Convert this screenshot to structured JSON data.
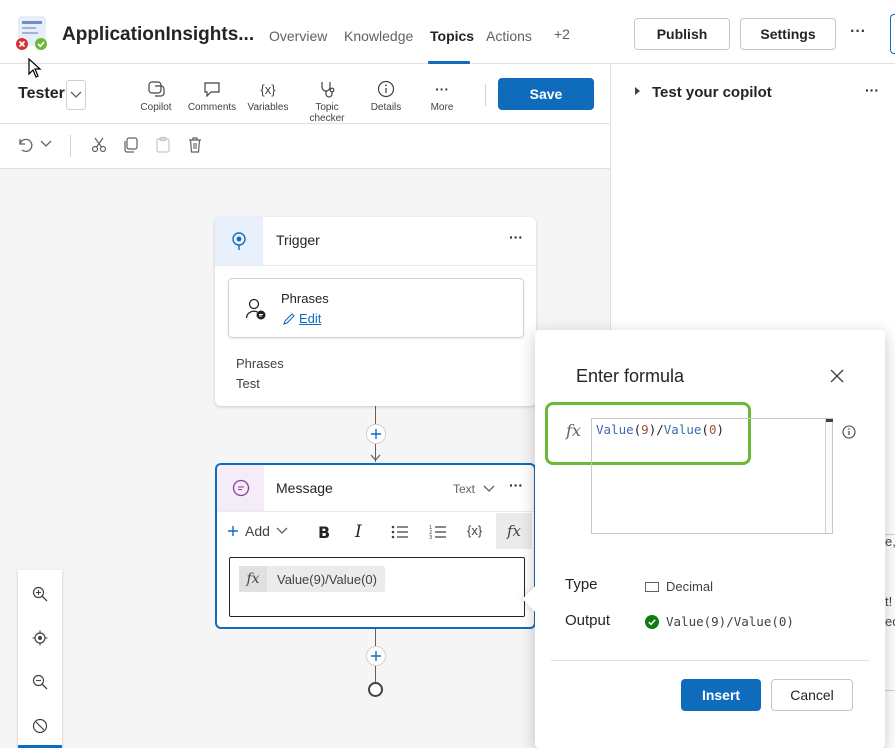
{
  "app": {
    "title": "ApplicationInsights..."
  },
  "nav_tabs": [
    {
      "label": "Overview"
    },
    {
      "label": "Knowledge"
    },
    {
      "label": "Topics",
      "active": true
    },
    {
      "label": "Actions"
    },
    {
      "label": "+2"
    }
  ],
  "header_actions": {
    "publish_label": "Publish",
    "settings_label": "Settings",
    "more_label": "···"
  },
  "topic": {
    "name": "Tester"
  },
  "toolbar": {
    "items": [
      {
        "label": "Copilot",
        "icon": "copilot-icon"
      },
      {
        "label": "Comments",
        "icon": "comment-icon"
      },
      {
        "label": "Variables",
        "icon": "variables-icon"
      },
      {
        "label": "Topic checker",
        "icon": "stethoscope-icon"
      },
      {
        "label": "Details",
        "icon": "info-icon"
      },
      {
        "label": "More",
        "icon": "more-icon"
      }
    ],
    "save_label": "Save"
  },
  "test_panel": {
    "title": "Test your copilot",
    "more_label": "···"
  },
  "trigger_node": {
    "title": "Trigger",
    "phrases_title": "Phrases",
    "edit_label": "Edit",
    "phrases_label": "Phrases",
    "phrases_value": "Test"
  },
  "message_node": {
    "title": "Message",
    "type_label": "Text",
    "add_label": "Add",
    "formula_text": "Value(9)/Value(0)"
  },
  "formula_dialog": {
    "title": "Enter formula",
    "fx_label": "fx",
    "formula_parts": [
      {
        "text": "Value",
        "kind": "fn"
      },
      {
        "text": "(",
        "kind": "punct"
      },
      {
        "text": "9",
        "kind": "num"
      },
      {
        "text": ")/",
        "kind": "punct"
      },
      {
        "text": "Value",
        "kind": "fn"
      },
      {
        "text": "(",
        "kind": "punct"
      },
      {
        "text": "0",
        "kind": "num"
      },
      {
        "text": ")",
        "kind": "punct"
      }
    ],
    "type_label": "Type",
    "type_value": "Decimal",
    "output_label": "Output",
    "output_value": "Value(9)/Value(0)",
    "insert_label": "Insert",
    "cancel_label": "Cancel"
  },
  "colors": {
    "accent": "#0f6cbd",
    "highlight": "#6bb83a",
    "success": "#107c10"
  }
}
